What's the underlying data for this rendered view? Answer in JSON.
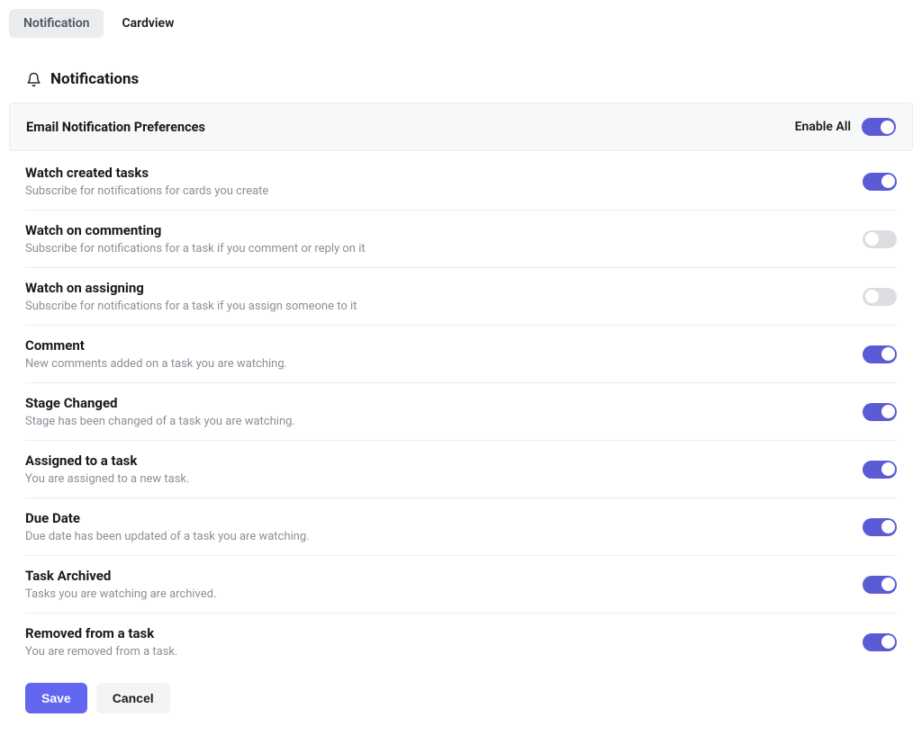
{
  "tabs": {
    "notification": "Notification",
    "cardview": "Cardview"
  },
  "page": {
    "title": "Notifications"
  },
  "section": {
    "title": "Email Notification Preferences",
    "enable_all_label": "Enable All",
    "enable_all_on": true
  },
  "preferences": [
    {
      "title": "Watch created tasks",
      "desc": "Subscribe for notifications for cards you create",
      "on": true
    },
    {
      "title": "Watch on commenting",
      "desc": "Subscribe for notifications for a task if you comment or reply on it",
      "on": false
    },
    {
      "title": "Watch on assigning",
      "desc": "Subscribe for notifications for a task if you assign someone to it",
      "on": false
    },
    {
      "title": "Comment",
      "desc": "New comments added on a task you are watching.",
      "on": true
    },
    {
      "title": "Stage Changed",
      "desc": "Stage has been changed of a task you are watching.",
      "on": true
    },
    {
      "title": "Assigned to a task",
      "desc": "You are assigned to a new task.",
      "on": true
    },
    {
      "title": "Due Date",
      "desc": "Due date has been updated of a task you are watching.",
      "on": true
    },
    {
      "title": "Task Archived",
      "desc": "Tasks you are watching are archived.",
      "on": true
    },
    {
      "title": "Removed from a task",
      "desc": "You are removed from a task.",
      "on": true
    }
  ],
  "buttons": {
    "save": "Save",
    "cancel": "Cancel"
  },
  "colors": {
    "accent": "#5b5bd6",
    "button_primary": "#6366f1",
    "toggle_off": "#dcdde0",
    "muted_text": "#8a8f98",
    "border": "#ebecef",
    "section_bg": "#f7f8fa"
  }
}
